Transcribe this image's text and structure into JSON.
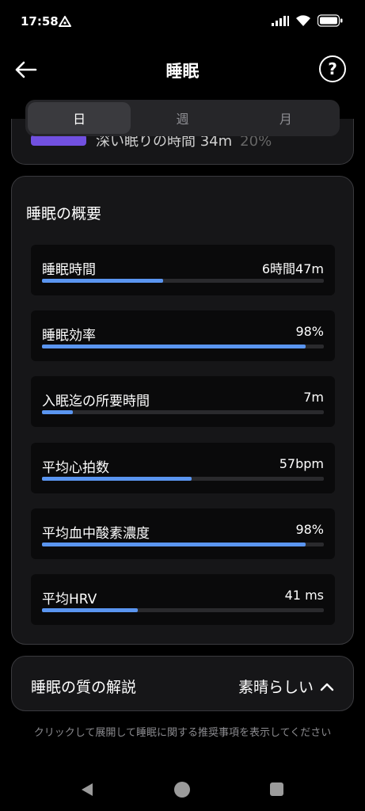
{
  "status_bar": {
    "time": "17:58"
  },
  "header": {
    "title": "睡眠",
    "help_glyph": "?"
  },
  "tabs": [
    {
      "label": "日",
      "active": true
    },
    {
      "label": "週",
      "active": false
    },
    {
      "label": "月",
      "active": false
    }
  ],
  "partial_card": {
    "text": "深い眠りの時間 34m",
    "percent": "20%",
    "bar_color": "#7150e0"
  },
  "summary": {
    "title": "睡眠の概要",
    "metrics": [
      {
        "label": "睡眠時間",
        "value": "6時間47m",
        "progress": 0.43
      },
      {
        "label": "睡眠効率",
        "value": "98%",
        "progress": 0.935
      },
      {
        "label": "入眠迄の所要時間",
        "value": "7m",
        "progress": 0.11
      },
      {
        "label": "平均心拍数",
        "value": "57bpm",
        "progress": 0.53
      },
      {
        "label": "平均血中酸素濃度",
        "value": "98%",
        "progress": 0.935
      },
      {
        "label": "平均HRV",
        "value": "41 ms",
        "progress": 0.34
      }
    ]
  },
  "quality": {
    "label": "睡眠の質の解説",
    "value": "素晴らしい"
  },
  "hint": "クリックして展開して睡眠に関する推奨事項を表示してください",
  "colors": {
    "progress_fill": "#5a95f0",
    "background": "#000000",
    "card": "#161618"
  }
}
